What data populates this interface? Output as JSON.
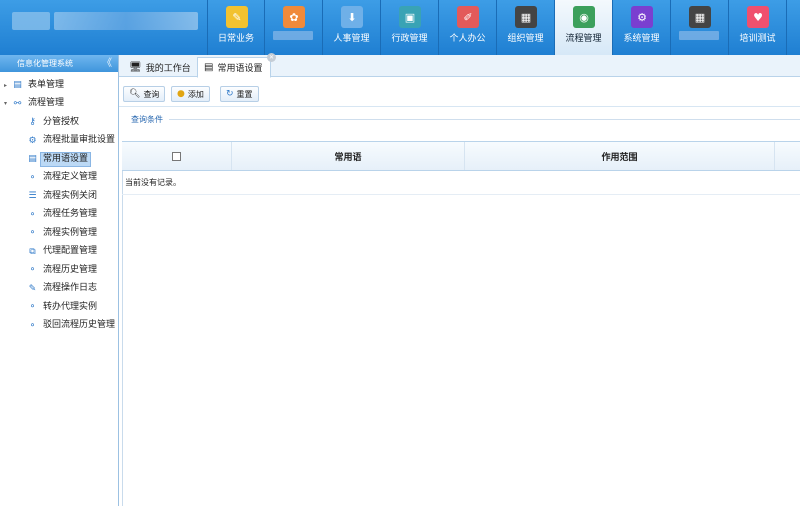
{
  "header": {
    "nav": [
      {
        "label": "日常业务",
        "icon": "note-icon",
        "color": "#f2c230"
      },
      {
        "label": "",
        "icon": "flower-icon",
        "color": "#f08a3a",
        "redacted": true
      },
      {
        "label": "人事管理",
        "icon": "person-icon",
        "color": "#6fb0e8"
      },
      {
        "label": "行政管理",
        "icon": "admin-icon",
        "color": "#39a3b5"
      },
      {
        "label": "个人办公",
        "icon": "pen-icon",
        "color": "#e35a5a"
      },
      {
        "label": "组织管理",
        "icon": "monitor-icon",
        "color": "#444444"
      },
      {
        "label": "流程管理",
        "icon": "flow-icon",
        "color": "#3ca05c",
        "active": true
      },
      {
        "label": "系统管理",
        "icon": "gear-icon",
        "color": "#7a3fd0"
      },
      {
        "label": "",
        "icon": "monitor-icon",
        "color": "#444444",
        "redacted": true
      },
      {
        "label": "培训测试",
        "icon": "heart-icon",
        "color": "#f0506e"
      }
    ]
  },
  "sidebar": {
    "title": "信息化管理系统",
    "collapse": "《",
    "top_items": [
      {
        "label": "表单管理",
        "arrow": "▸",
        "icon": "form-icon"
      },
      {
        "label": "流程管理",
        "arrow": "▾",
        "icon": "workflow-icon"
      }
    ],
    "children": [
      {
        "label": "分管授权",
        "icon": "user-key-icon"
      },
      {
        "label": "流程批量审批设置",
        "icon": "gear-icon"
      },
      {
        "label": "常用语设置",
        "icon": "phrase-icon",
        "selected": true
      },
      {
        "label": "流程定义管理",
        "icon": "flow-node-icon"
      },
      {
        "label": "流程实例关闭",
        "icon": "list-icon"
      },
      {
        "label": "流程任务管理",
        "icon": "flow-node-icon"
      },
      {
        "label": "流程实例管理",
        "icon": "flow-node-icon"
      },
      {
        "label": "代理配置管理",
        "icon": "proxy-icon"
      },
      {
        "label": "流程历史管理",
        "icon": "flow-node-icon"
      },
      {
        "label": "流程操作日志",
        "icon": "log-icon"
      },
      {
        "label": "转办代理实例",
        "icon": "flow-node-icon"
      },
      {
        "label": "驳回流程历史管理",
        "icon": "flow-node-icon"
      }
    ]
  },
  "tabs": [
    {
      "label": "我的工作台",
      "icon": "desktop-icon"
    },
    {
      "label": "常用语设置",
      "icon": "phrase-icon",
      "active": true
    }
  ],
  "toolbar": {
    "query": "查询",
    "add": "添加",
    "reset": "重置"
  },
  "query_section": {
    "label": "查询条件"
  },
  "grid": {
    "columns": [
      "",
      "常用语",
      "作用范围",
      ""
    ],
    "empty_text": "当前没有记录。"
  }
}
